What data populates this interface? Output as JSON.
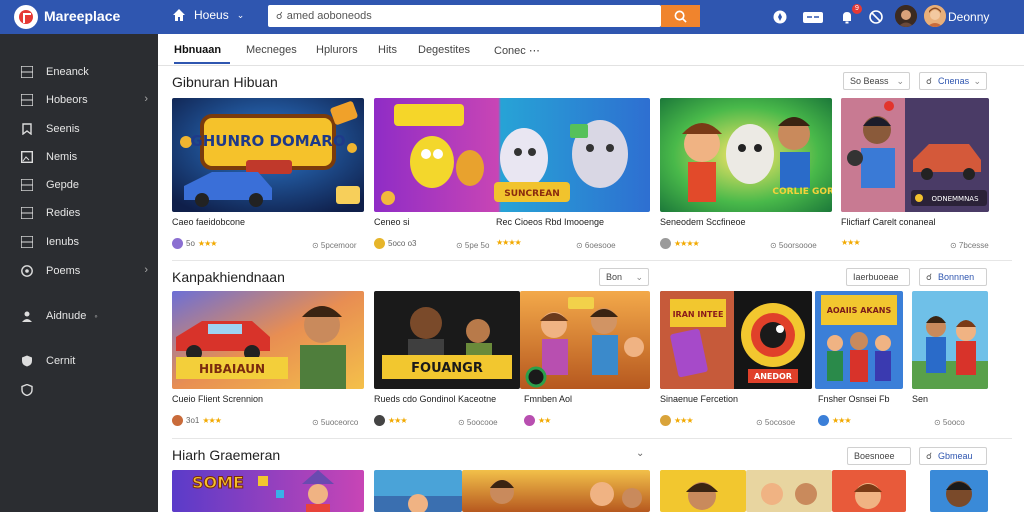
{
  "header": {
    "brand": "Mareeplace",
    "home_label": "Hoeus",
    "search_placeholder": "amed aoboneods",
    "username": "Deonny",
    "notification_count": "9"
  },
  "sidebar": {
    "items": [
      {
        "label": "Eneanck",
        "icon": "grid-icon"
      },
      {
        "label": "Hobeors",
        "icon": "grid-icon"
      },
      {
        "label": "Seenis",
        "icon": "bookmark-icon"
      },
      {
        "label": "Nemis",
        "icon": "image-icon"
      },
      {
        "label": "Gepde",
        "icon": "grid-icon"
      },
      {
        "label": "Redies",
        "icon": "grid-icon"
      },
      {
        "label": "Ienubs",
        "icon": "grid-icon"
      },
      {
        "label": "Poems",
        "icon": "globe-icon"
      },
      {
        "label": "Aidnude",
        "icon": "person-icon"
      },
      {
        "label": "Cernit",
        "icon": "shield-icon"
      },
      {
        "label": "",
        "icon": "shield-icon"
      }
    ]
  },
  "tabs": [
    "Hbnuaan",
    "Mecneges",
    "Hplurors",
    "Hits",
    "Degestites",
    "Conec"
  ],
  "sections": [
    {
      "title": "Gibnuran Hibuan",
      "filter": "So Beass",
      "action": "Cnenas",
      "cards": [
        {
          "title": "Caeo faeidobcone",
          "meta": "5o",
          "price": "⊙ 5pcemoor"
        },
        {
          "title": "Ceneo si",
          "meta": "5oco o3",
          "price": "⊙ 5pe 5o"
        },
        {
          "title": "Rec Cioeos Rbd Imooenge",
          "meta": "",
          "price": "⊙ 6oesooe"
        },
        {
          "title": "Seneodem Sccfineoe",
          "meta": "",
          "price": "⊙ 5oorsoooe"
        },
        {
          "title": "Flicfiarf Carelt conaneal",
          "meta": "",
          "price": "⊙ 7bcesse"
        }
      ]
    },
    {
      "title": "Kanpakhiendnaan",
      "filter": "Bon",
      "sort": "Iaerbuoeae",
      "action": "Bonnnen",
      "cards": [
        {
          "title": "Cueio Flient Scrennion",
          "meta": "3o1",
          "price": "⊙ 5uoceorco"
        },
        {
          "title": "Rueds cdo Gondinol Kaceotne",
          "meta": "",
          "price": "⊙ 5oocooe"
        },
        {
          "title": "Fmnben Aol",
          "meta": "",
          "price": ""
        },
        {
          "title": "Sinaenue Fercetion",
          "meta": "",
          "price": "⊙ 5ocosoe"
        },
        {
          "title": "Fnsher Osnsei Fb",
          "meta": "",
          "price": ""
        },
        {
          "title": "Sen",
          "meta": "",
          "price": "⊙ 5ooco"
        }
      ]
    },
    {
      "title": "Hiarh Graemeran",
      "sort": "Boesnoee",
      "action": "Gbmeau"
    }
  ],
  "art_text": {
    "c1": "GHUNRO DOMARO",
    "c2": "SUNCREAN",
    "c3": "CORLIE GORDE",
    "c4": "ODNEMMNAS",
    "r2c1": "HIBAIAUN",
    "r2c2": "FOUANGR",
    "r2c3": "IRAN INTEE",
    "r2c4": "ANEDOR",
    "r2c5": "AOAIIS AKANS",
    "r3c1": "SOME"
  },
  "colors": {
    "topbar": "#2f56b0",
    "sidebar": "#2b2d31",
    "accent": "#2f56b0",
    "search_button": "#f0842d",
    "star": "#f2a900"
  }
}
